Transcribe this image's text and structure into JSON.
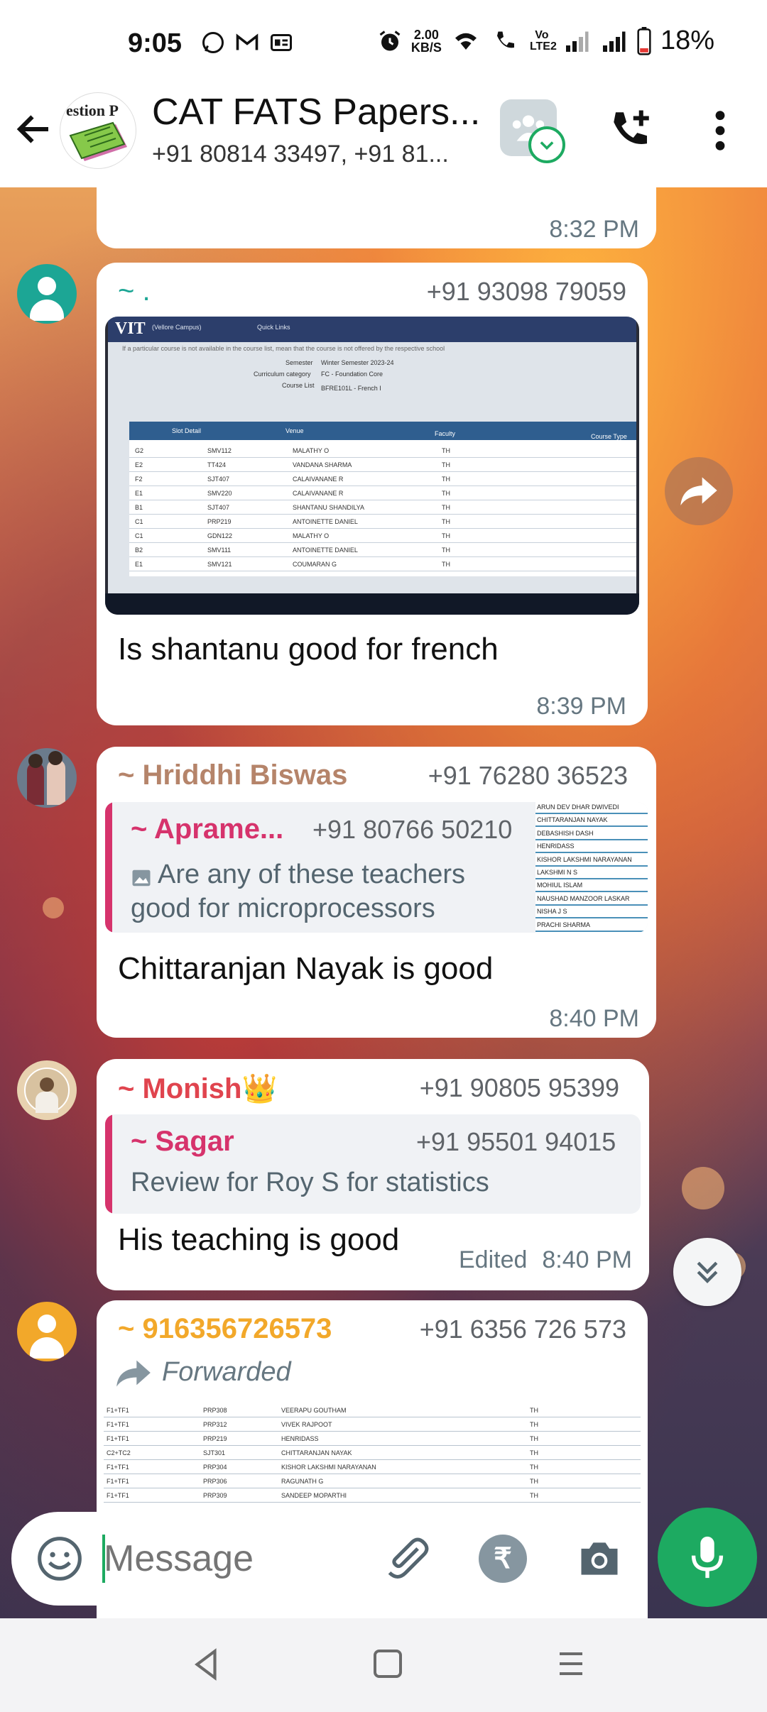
{
  "status_bar": {
    "time": "9:05",
    "net_speed_top": "2.00",
    "net_speed_unit": "KB/S",
    "volte": "Vo LTE2",
    "battery": "18%",
    "icons": [
      "whatsapp-icon",
      "gmail-icon",
      "news-icon",
      "alarm-icon",
      "wifi-icon",
      "wifi-calling-icon",
      "signal-icon",
      "signal-icon",
      "battery-icon"
    ]
  },
  "header": {
    "avatar_text": "estion P",
    "title": "CAT FATS Papers...",
    "subtitle": "+91 80814 33497, +91 81..."
  },
  "messages": [
    {
      "time": "8:32 PM"
    },
    {
      "sender": "~ .",
      "phone": "+91 93098 79059",
      "photo": {
        "logo": "VIT",
        "campus": "(Vellore Campus)",
        "quick_links": "Quick Links",
        "notice": "If a particular course is not available in the course list, mean that the course is not offered by the respective school",
        "semester_label": "Semester",
        "semester_value": "Winter Semester 2023-24",
        "category_label": "Curriculum category",
        "category_value": "FC - Foundation Core",
        "course_label": "Course List",
        "course_value": "BFRE101L - French I",
        "columns": [
          "Slot Detail",
          "Venue",
          "Faculty",
          "Course Type"
        ],
        "rows": [
          [
            "G2",
            "SMV112",
            "MALATHY O",
            "TH"
          ],
          [
            "E2",
            "TT424",
            "VANDANA SHARMA",
            "TH"
          ],
          [
            "F2",
            "SJT407",
            "CALAIVANANE R",
            "TH"
          ],
          [
            "E1",
            "SMV220",
            "CALAIVANANE R",
            "TH"
          ],
          [
            "B1",
            "SJT407",
            "SHANTANU SHANDILYA",
            "TH"
          ],
          [
            "C1",
            "PRP219",
            "ANTOINETTE DANIEL",
            "TH"
          ],
          [
            "C1",
            "GDN122",
            "MALATHY O",
            "TH"
          ],
          [
            "B2",
            "SMV111",
            "ANTOINETTE DANIEL",
            "TH"
          ],
          [
            "E1",
            "SMV121",
            "COUMARAN G",
            "TH"
          ]
        ]
      },
      "text": "Is shantanu good for french",
      "time": "8:39 PM"
    },
    {
      "sender": "~ Hriddhi Biswas",
      "phone": "+91 76280 36523",
      "quote": {
        "sender": "~ Aprame...",
        "phone": "+91 80766 50210",
        "text": "Are any of these teachers good for microprocessors",
        "thumb_names": [
          "ARUN DEV DHAR DWIVEDI",
          "CHITTARANJAN NAYAK",
          "DEBASHISH DASH",
          "HENRIDASS",
          "KISHOR LAKSHMI NARAYANAN",
          "LAKSHMI N S",
          "MOHIUL ISLAM",
          "NAUSHAD MANZOOR LASKAR",
          "NISHA J S",
          "PRACHI SHARMA"
        ]
      },
      "text": "Chittaranjan Nayak is good",
      "time": "8:40 PM"
    },
    {
      "sender": "~ Monish👑",
      "phone": "+91 90805 95399",
      "quote": {
        "sender": "~ Sagar",
        "phone": "+91 95501 94015",
        "text": "Review for Roy S for statistics"
      },
      "text": "His teaching is good",
      "edited": "Edited",
      "time": "8:40 PM"
    },
    {
      "sender": "~ 916356726573",
      "phone": "+91 6356 726 573",
      "forwarded": "Forwarded",
      "table": [
        [
          "F1+TF1",
          "PRP308",
          "VEERAPU GOUTHAM",
          "TH"
        ],
        [
          "F1+TF1",
          "PRP312",
          "VIVEK RAJPOOT",
          "TH"
        ],
        [
          "F1+TF1",
          "PRP219",
          "HENRIDASS",
          "TH"
        ],
        [
          "C2+TC2",
          "SJT301",
          "CHITTARANJAN NAYAK",
          "TH"
        ],
        [
          "F1+TF1",
          "PRP304",
          "KISHOR LAKSHMI NARAYANAN",
          "TH"
        ],
        [
          "F1+TF1",
          "PRP306",
          "RAGUNATH G",
          "TH"
        ],
        [
          "F1+TF1",
          "PRP309",
          "SANDEEP MOPARTHI",
          "TH"
        ]
      ]
    }
  ],
  "composer": {
    "placeholder": "Message",
    "rupee": "₹"
  },
  "colors": {
    "whatsapp_green": "#1DAA61",
    "sender_hriddhi": "#b5846a",
    "sender_apramey": "#d6336c",
    "sender_monish": "#e0444e",
    "sender_sagar": "#d6336c",
    "sender_916": "#f2a82a"
  }
}
